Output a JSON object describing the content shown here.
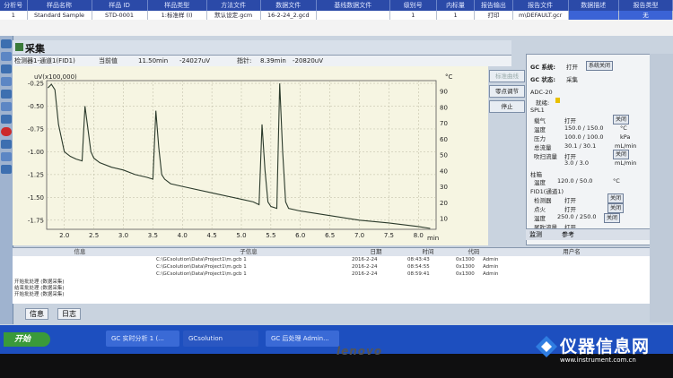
{
  "sequence_table": {
    "headers": [
      "分析号",
      "样品名称",
      "样品 ID",
      "样品类型",
      "方法文件",
      "数据文件",
      "基线数据文件",
      "级别号",
      "内标量",
      "报告输出",
      "报告文件",
      "数据描述",
      "报告类型"
    ],
    "row": [
      "1",
      "Standard Sample",
      "STD-0001",
      "1:标准样 (I)",
      "默认设定.gcm",
      "16-2-24_2.gcd",
      "",
      "1",
      "1",
      "打印",
      "m\\DEFAULT.gcr",
      "",
      "无"
    ]
  },
  "window": {
    "title": "采集",
    "signal_label": "检测器1-通道1(FID1)",
    "time_label": "当前值",
    "time_value": "11.50min",
    "signal_value": "-24027uV",
    "param_label": "指针:",
    "param_time": "8.39min",
    "param_value": "-20820uV"
  },
  "chart_data": {
    "type": "line",
    "title": "",
    "y_unit_label": "uV(x100,000)",
    "xlabel": "min",
    "ylabel": "",
    "xlim": [
      1.7,
      8.3
    ],
    "ylim": [
      -1.85,
      -0.22
    ],
    "x_ticks": [
      "2.0",
      "2.5",
      "3.0",
      "3.5",
      "4.0",
      "4.5",
      "5.0",
      "5.5",
      "6.0",
      "6.5",
      "7.0",
      "7.5",
      "8.0"
    ],
    "y_ticks": [
      "-0.25",
      "-0.50",
      "-0.75",
      "-1.00",
      "-1.25",
      "-1.50",
      "-1.75"
    ],
    "y2_unit_label": "°C",
    "y2_ticks": [
      "90",
      "80",
      "70",
      "60",
      "50",
      "40",
      "30",
      "20",
      "10"
    ],
    "x": [
      1.72,
      1.78,
      1.84,
      1.9,
      2.0,
      2.1,
      2.2,
      2.3,
      2.35,
      2.4,
      2.45,
      2.5,
      2.6,
      2.8,
      3.0,
      3.2,
      3.4,
      3.5,
      3.55,
      3.6,
      3.65,
      3.7,
      3.8,
      4.0,
      4.5,
      5.0,
      5.2,
      5.3,
      5.35,
      5.4,
      5.45,
      5.5,
      5.6,
      5.65,
      5.7,
      5.75,
      5.8,
      6.0,
      6.5,
      7.0,
      7.5,
      8.0,
      8.2
    ],
    "y": [
      -0.3,
      -0.26,
      -0.32,
      -0.7,
      -1.0,
      -1.05,
      -1.08,
      -1.1,
      -0.5,
      -0.75,
      -1.0,
      -1.07,
      -1.12,
      -1.17,
      -1.2,
      -1.25,
      -1.28,
      -1.3,
      -0.55,
      -0.95,
      -1.25,
      -1.3,
      -1.35,
      -1.38,
      -1.45,
      -1.52,
      -1.55,
      -1.58,
      -0.7,
      -1.2,
      -1.55,
      -1.6,
      -1.62,
      -0.25,
      -1.0,
      -1.55,
      -1.62,
      -1.65,
      -1.7,
      -1.75,
      -1.78,
      -1.82,
      -1.84
    ],
    "series": [
      {
        "values": []
      }
    ],
    "grid": true
  },
  "right_buttons": [
    "标准曲线",
    "零点调节",
    "停止"
  ],
  "gc_panel": {
    "system_label": "GC 系统:",
    "system_value": "打开",
    "system_btn": "系统关闭",
    "status_label": "GC 状态:",
    "status_value": "采集",
    "adc_label": "ADC-20",
    "ready_label": "就绪:",
    "spl_label": "SPL1",
    "carrier_label": "载气",
    "carrier_value": "打开",
    "carrier_btn": "关闭",
    "temp_label": "温度",
    "temp_value": "150.0 / 150.0",
    "temp_unit": "°C",
    "pressure_label": "压力",
    "pressure_value": "100.0 / 100.0",
    "pressure_unit": "kPa",
    "totalflow_label": "总流量",
    "totalflow_value": "30.1 / 30.1",
    "totalflow_unit": "mL/min",
    "purge_label": "吹扫流量",
    "purge_value": "打开",
    "purge_btn": "关闭",
    "purge_num": "3.0 / 3.0",
    "purge_unit": "mL/min",
    "column_label": "柱箱",
    "column_temp_label": "温度",
    "column_temp_value": "120.0 / 50.0",
    "column_unit": "°C",
    "fid_label": "FID1(通道1)",
    "det_label": "检测器",
    "det_value": "打开",
    "det_btn": "关闭",
    "ignite_label": "点火",
    "ignite_value": "打开",
    "ignite_btn": "关闭",
    "fid_temp_label": "温度",
    "fid_temp_value": "250.0 / 250.0",
    "makeup_label": "尾吹流量",
    "makeup_value": "打开",
    "makeup_btn": "关闭"
  },
  "panel_tabs": [
    "监测",
    "参考"
  ],
  "log": {
    "headers": [
      "信息",
      "子信息",
      "日期",
      "时间",
      "代码",
      "用户名"
    ],
    "rows": [
      {
        "info": "开始批处理 (数据采集)",
        "sub": "C:\\GCsolution\\Data\\Project1\\m.gcb  1",
        "date": "2016-2-24",
        "time": "08:43:43",
        "code": "0x1300",
        "user": "Admin"
      },
      {
        "info": "结束批处理 (数据采集)",
        "sub": "C:\\GCsolution\\Data\\Project1\\m.gcb  1",
        "date": "2016-2-24",
        "time": "08:54:55",
        "code": "0x1300",
        "user": "Admin"
      },
      {
        "info": "开始批处理 (数据采集)",
        "sub": "C:\\GCsolution\\Data\\Project1\\m.gcb  1",
        "date": "2016-2-24",
        "time": "08:59:41",
        "code": "0x1300",
        "user": "Admin"
      }
    ]
  },
  "bottom_tabs": [
    "信息",
    "日志"
  ],
  "taskbar": {
    "start": "开始",
    "items": [
      "GC 实时分析 1 (...",
      "GCsolution",
      "GC 后处理 Admin..."
    ]
  },
  "brand": "lenovo",
  "watermark": {
    "name": "仪器信息网",
    "url": "www.instrument.com.cn"
  },
  "colors": {
    "trace": "#2b3a2b",
    "plot_bg": "#efeed6",
    "taskbar": "#1d4fbf",
    "seq_header": "#2b4aa8"
  }
}
